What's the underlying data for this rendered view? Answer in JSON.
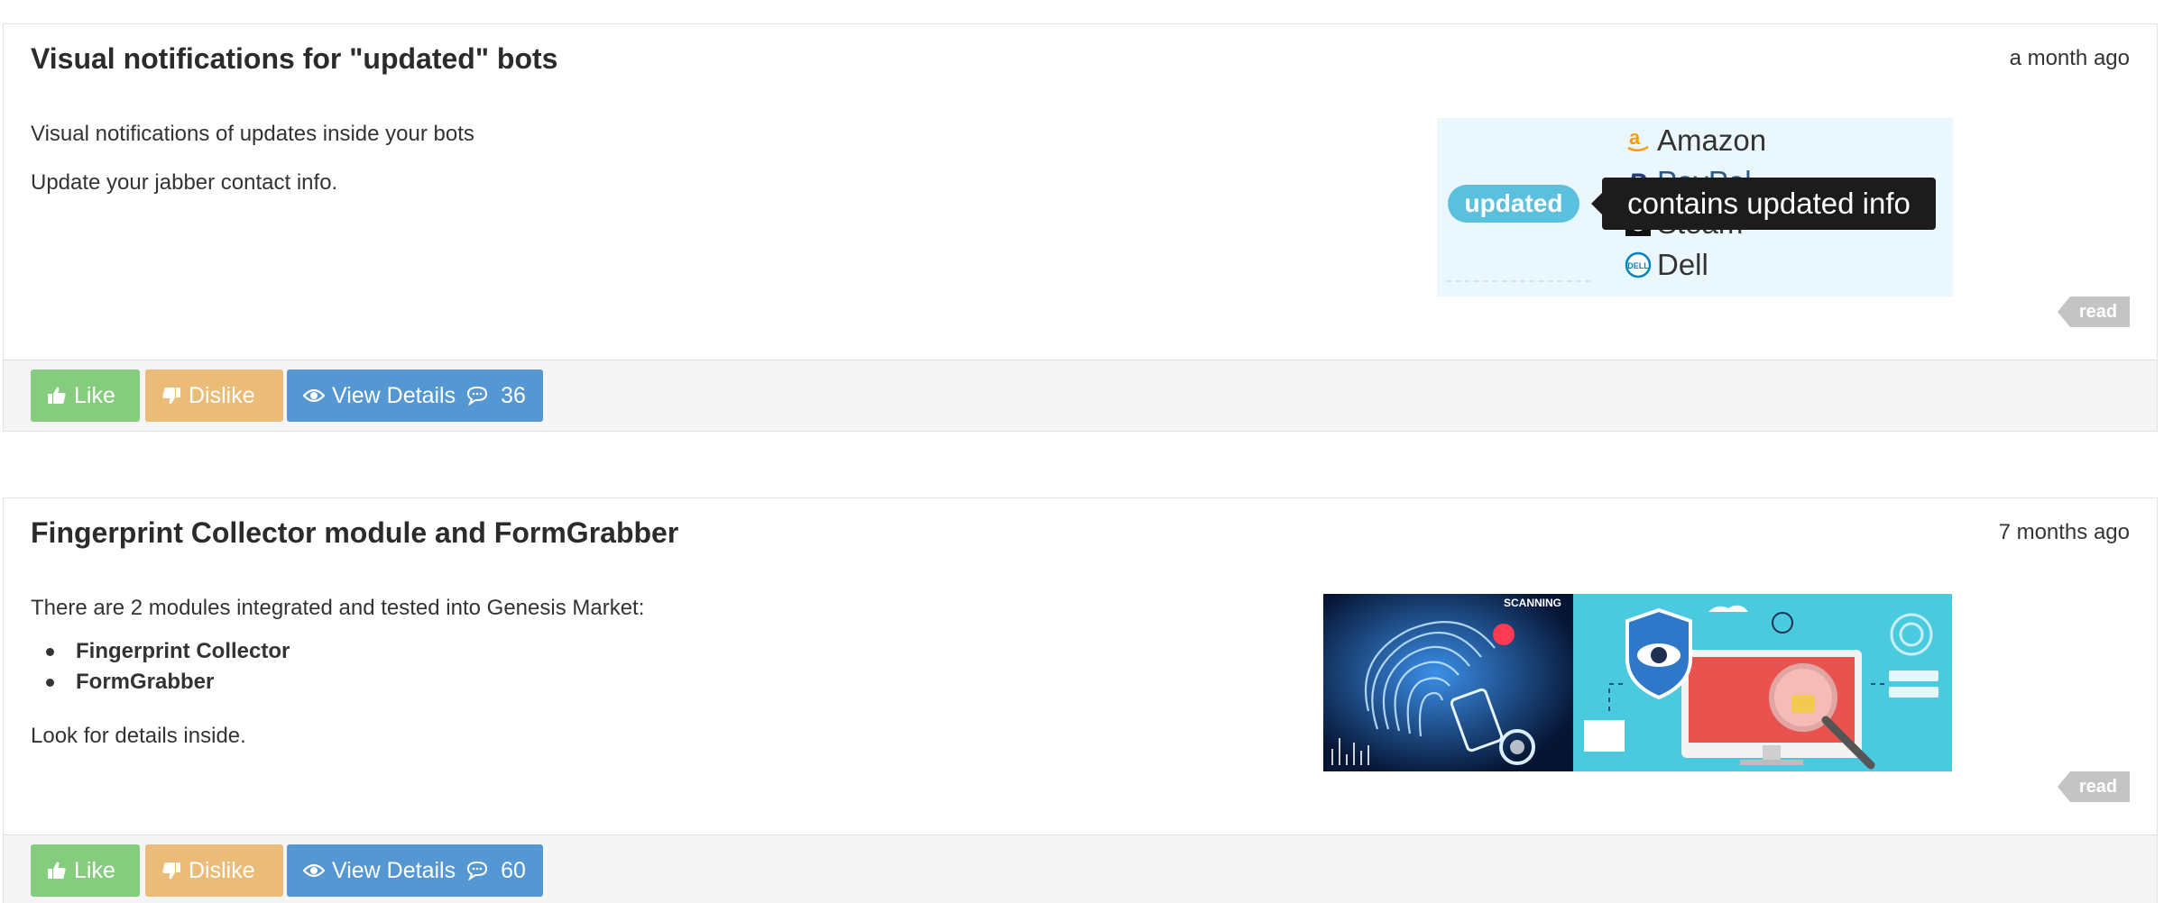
{
  "posts": [
    {
      "title": "Visual notifications for \"updated\" bots",
      "time": "a month ago",
      "paragraphs": [
        "Visual notifications of updates inside your bots",
        "Update your jabber contact info."
      ],
      "illustration": {
        "brands": [
          "Amazon",
          "PayPal",
          "Steam",
          "Dell"
        ],
        "badge": "updated",
        "tooltip": "contains updated info"
      },
      "read_tag": "read",
      "actions": {
        "like": "Like",
        "dislike": "Dislike",
        "details": "View Details",
        "comments": "36"
      }
    },
    {
      "title": "Fingerprint Collector module and FormGrabber",
      "time": "7 months ago",
      "intro": "There are 2 modules integrated and tested into Genesis Market:",
      "bullets": [
        "Fingerprint Collector",
        "FormGrabber"
      ],
      "outro": "Look for details inside.",
      "illustration": {
        "overlay_text": "SCANNING"
      },
      "read_tag": "read",
      "actions": {
        "like": "Like",
        "dislike": "Dislike",
        "details": "View Details",
        "comments": "60"
      }
    }
  ],
  "colors": {
    "like": "#86cc7e",
    "dislike": "#ebbc77",
    "details": "#5597d3",
    "badge": "#5bc0de",
    "read_tag": "#c4c4c4"
  }
}
